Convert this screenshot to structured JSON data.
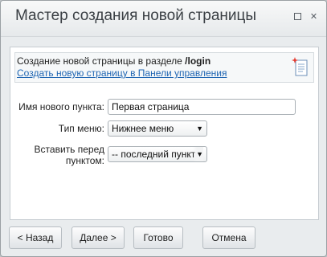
{
  "dialog": {
    "title": "Мастер создания новой страницы",
    "controls": {
      "maximize_icon": "maximize-icon",
      "close_icon": "close-icon",
      "close_glyph": "✕"
    }
  },
  "info": {
    "text_prefix": "Создание новой страницы в разделе ",
    "section": "/login",
    "link": "Создать новую страницу в Панели управления",
    "icon": "new-page-icon"
  },
  "form": {
    "item_name": {
      "label": "Имя нового пункта:",
      "value": "Первая страница"
    },
    "menu_type": {
      "label": "Тип меню:",
      "selected": "Нижнее меню"
    },
    "insert_before": {
      "label_line1": "Вставить перед",
      "label_line2": "пунктом:",
      "selected": "-- последний пункт -"
    }
  },
  "buttons": {
    "back": "< Назад",
    "next": "Далее >",
    "done": "Готово",
    "cancel": "Отмена"
  },
  "colors": {
    "link": "#2066b3",
    "background": "#e9ecee"
  }
}
